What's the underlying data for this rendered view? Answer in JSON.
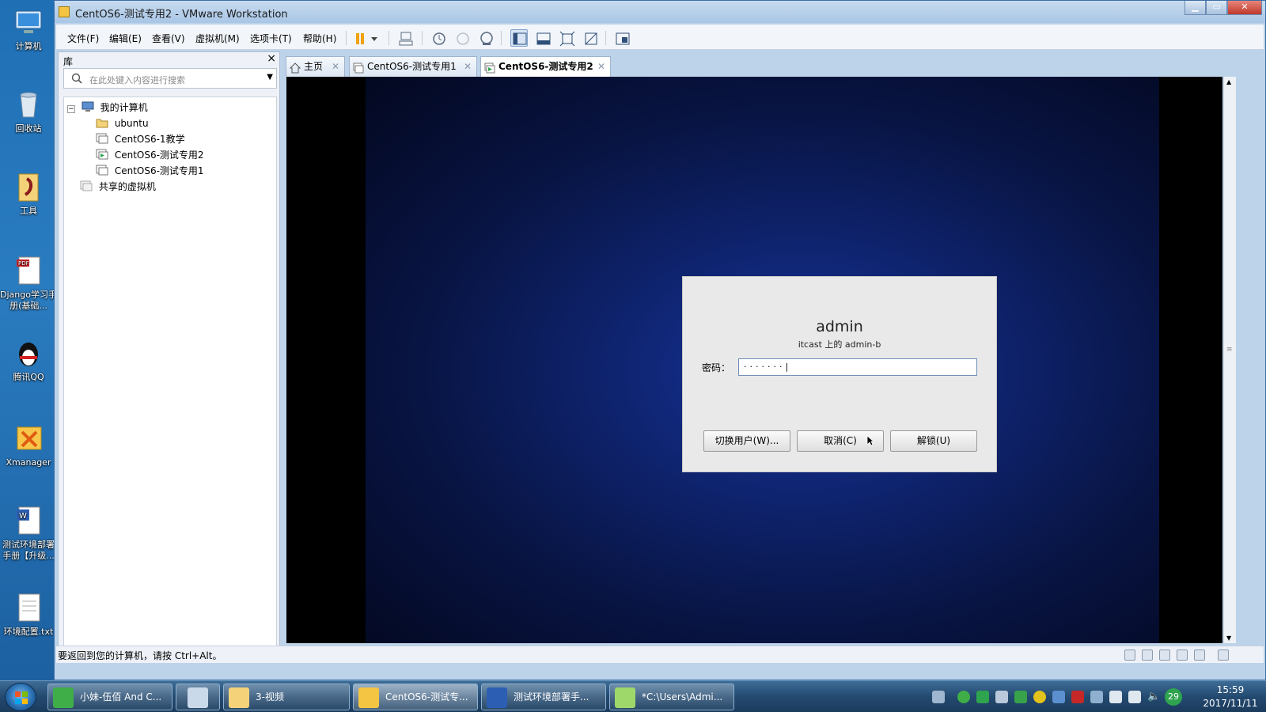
{
  "desktop": {
    "icons": [
      {
        "label": "计算机"
      },
      {
        "label": "回收站"
      },
      {
        "label": "工具"
      },
      {
        "label": "Django学习手册(基础..."
      },
      {
        "label": "腾讯QQ"
      },
      {
        "label": "Xmanager"
      },
      {
        "label": "测试环境部署手册【升级..."
      },
      {
        "label": "环境配置.txt"
      }
    ]
  },
  "window": {
    "title": "CentOS6-测试专用2 - VMware Workstation",
    "menu": [
      "文件(F)",
      "编辑(E)",
      "查看(V)",
      "虚拟机(M)",
      "选项卡(T)",
      "帮助(H)"
    ]
  },
  "library": {
    "header": "库",
    "close": "×",
    "search_placeholder": "在此处键入内容进行搜索",
    "tree": [
      {
        "label": "我的计算机",
        "kind": "computer"
      },
      {
        "label": "ubuntu",
        "kind": "folder"
      },
      {
        "label": "CentOS6-1教学",
        "kind": "vm"
      },
      {
        "label": "CentOS6-测试专用2",
        "kind": "vm-running"
      },
      {
        "label": "CentOS6-测试专用1",
        "kind": "vm"
      },
      {
        "label": "共享的虚拟机",
        "kind": "shared"
      }
    ]
  },
  "tabs": [
    {
      "label": "主页",
      "active": false
    },
    {
      "label": "CentOS6-测试专用1",
      "active": false
    },
    {
      "label": "CentOS6-测试专用2",
      "active": true
    }
  ],
  "unlock_dialog": {
    "username": "admin",
    "host": "itcast 上的 admin-b",
    "password_label": "密码：",
    "password_value": "·······|",
    "buttons": {
      "switch_user": "切换用户(W)...",
      "cancel": "取消(C)",
      "unlock": "解锁(U)"
    }
  },
  "statusbar": {
    "message": "要返回到您的计算机，请按 Ctrl+Alt。"
  },
  "taskbar": {
    "items": [
      {
        "label": "小妹-伍佰 And C..."
      },
      {
        "label": ""
      },
      {
        "label": "3-视频"
      },
      {
        "label": "CentOS6-测试专..."
      },
      {
        "label": "测试环境部署手..."
      },
      {
        "label": "*C:\\Users\\Admi..."
      }
    ],
    "tray_badge": "29",
    "clock_time": "15:59",
    "clock_date": "2017/11/11"
  },
  "colors": {
    "accent": "#2a6fb2",
    "guest_bg": "#0f2470"
  }
}
